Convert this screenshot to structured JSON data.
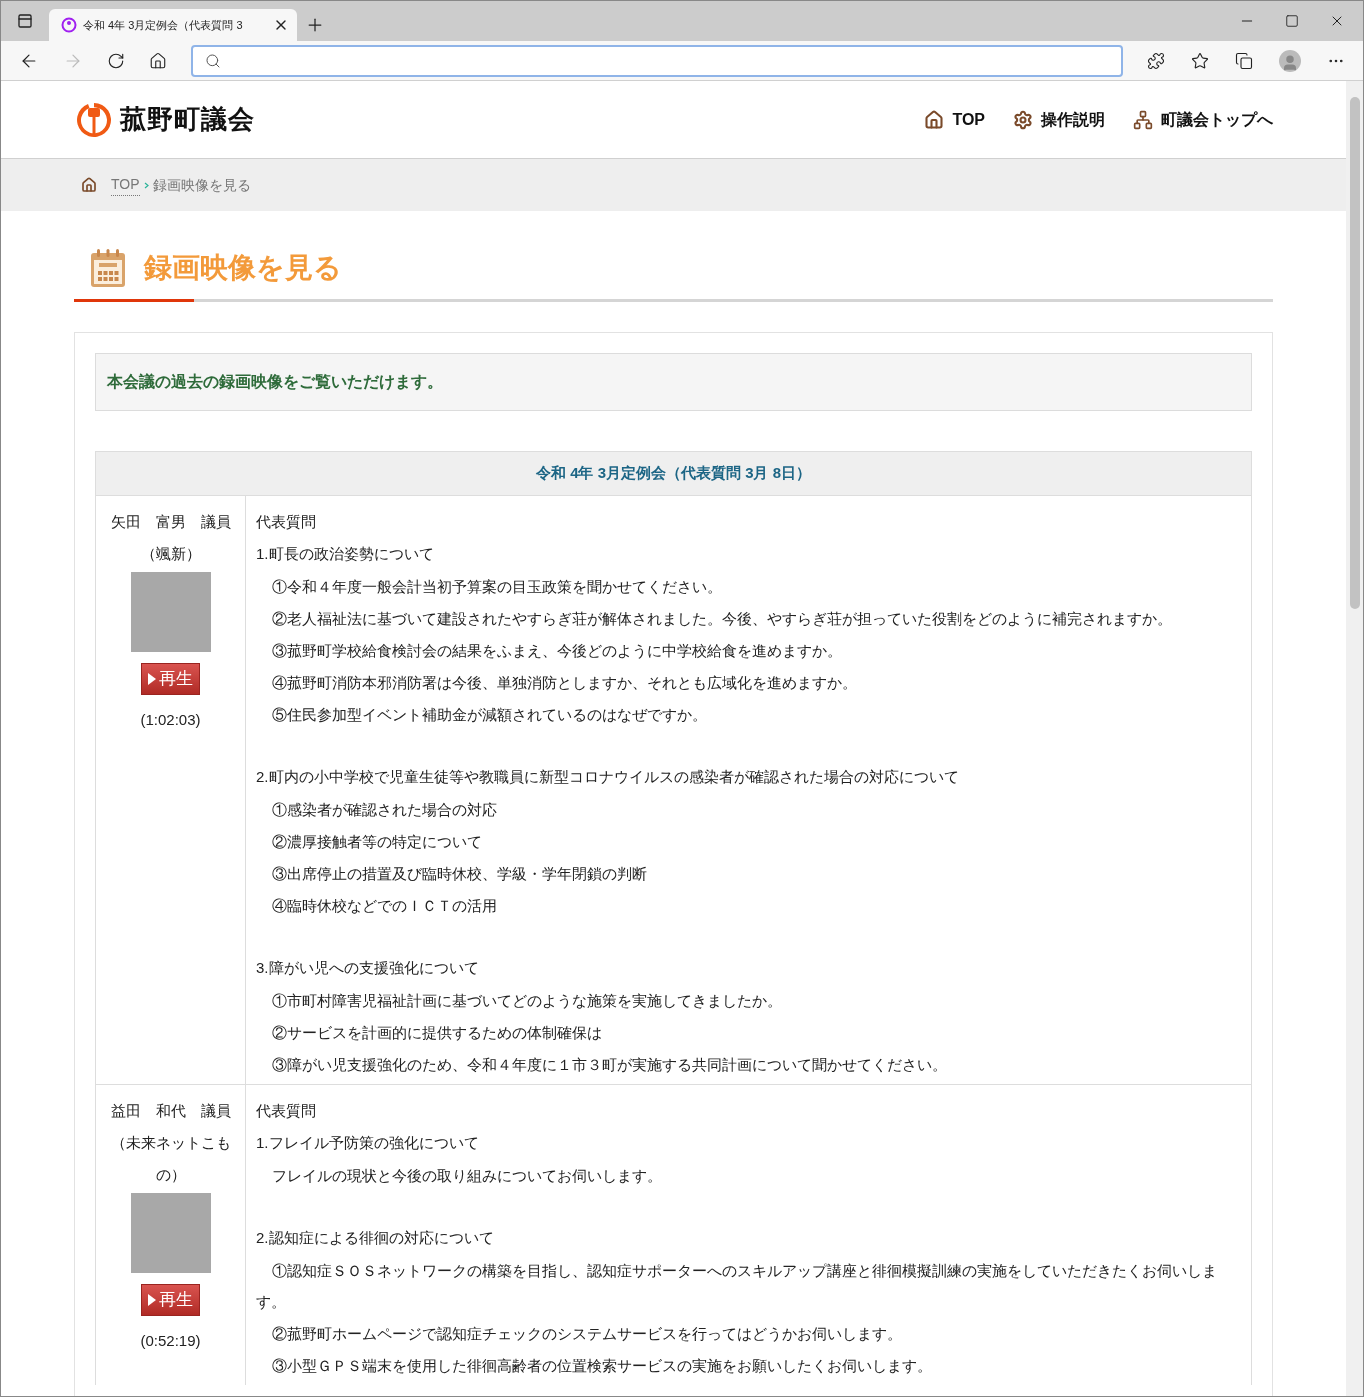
{
  "browser": {
    "tab_title": "令和 4年 3月定例会（代表質問 3"
  },
  "site": {
    "logo_text": "菰野町議会",
    "nav": [
      {
        "kind": "home",
        "label": "TOP"
      },
      {
        "kind": "gear",
        "label": "操作説明"
      },
      {
        "kind": "sitemap",
        "label": "町議会トップへ"
      }
    ]
  },
  "breadcrumb": {
    "items": [
      "TOP",
      "録画映像を見る"
    ]
  },
  "page_title": "録画映像を見る",
  "intro": "本会議の過去の録画映像をご覧いただけます。",
  "table": {
    "title": "令和 4年 3月定例会（代表質問 3月 8日）",
    "rows": [
      {
        "name": "矢田　富男　議員",
        "party": "（颯新）",
        "play": "再生",
        "duration": "(1:02:03)",
        "heading": "代表質問",
        "topics": [
          {
            "title": "1.町長の政治姿勢について",
            "items": [
              "①令和４年度一般会計当初予算案の目玉政策を聞かせてください。",
              "②老人福祉法に基づいて建設されたやすらぎ荘が解体されました。今後、やすらぎ荘が担っていた役割をどのように補完されますか。",
              "③菰野町学校給食検討会の結果をふまえ、今後どのように中学校給食を進めますか。",
              "④菰野町消防本邪消防署は今後、単独消防としますか、それとも広域化を進めますか。",
              "⑤住民参加型イベント補助金が減額されているのはなぜですか。"
            ]
          },
          {
            "title": "2.町内の小中学校で児童生徒等や教職員に新型コロナウイルスの感染者が確認された場合の対応について",
            "items": [
              "①感染者が確認された場合の対応",
              "②濃厚接触者等の特定について",
              "③出席停止の措置及び臨時休校、学級・学年閉鎖の判断",
              "④臨時休校などでのＩＣＴの活用"
            ]
          },
          {
            "title": "3.障がい児への支援強化について",
            "items": [
              "①市町村障害児福祉計画に基づいてどのような施策を実施してきましたか。",
              "②サービスを計画的に提供するための体制確保は",
              "③障がい児支援強化のため、令和４年度に１市３町が実施する共同計画について聞かせてください。"
            ]
          }
        ]
      },
      {
        "name": "益田　和代　議員",
        "party": "（未来ネットこもの）",
        "play": "再生",
        "duration": "(0:52:19)",
        "heading": "代表質問",
        "topics": [
          {
            "title": "1.フレイル予防策の強化について",
            "items": [
              "フレイルの現状と今後の取り組みについてお伺いします。"
            ]
          },
          {
            "title": "2.認知症による徘徊の対応について",
            "items": [
              "①認知症ＳＯＳネットワークの構築を目指し、認知症サポーターへのスキルアップ講座と徘徊模擬訓練の実施をしていただきたくお伺いします。",
              "②菰野町ホームページで認知症チェックのシステムサービスを行ってはどうかお伺いします。",
              "③小型ＧＰＳ端末を使用した徘徊高齢者の位置検索サービスの実施をお願いしたくお伺いします。"
            ]
          }
        ]
      }
    ]
  }
}
